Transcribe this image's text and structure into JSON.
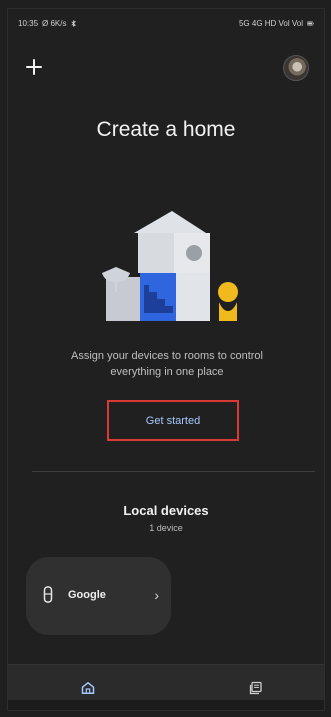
{
  "status_bar": {
    "time": "10:35",
    "left_extra": "Ø 6K/s",
    "right_text": "5G 4G HD Vol Vol"
  },
  "header": {
    "title": "Create a home"
  },
  "main": {
    "description": "Assign your devices to rooms to control everything in one place",
    "cta_label": "Get started"
  },
  "local_devices": {
    "title": "Local devices",
    "count_label": "1 device",
    "devices": [
      {
        "name": "Google",
        "icon": "speaker-icon"
      }
    ]
  },
  "nav": {
    "items": [
      {
        "icon": "home-icon"
      },
      {
        "icon": "activity-icon"
      }
    ]
  },
  "colors": {
    "background": "#202020",
    "accent": "#a5c8ff",
    "highlight": "#d83b35",
    "card": "#303030",
    "illustration_blue": "#2f65df",
    "illustration_yellow": "#f0b91d"
  }
}
